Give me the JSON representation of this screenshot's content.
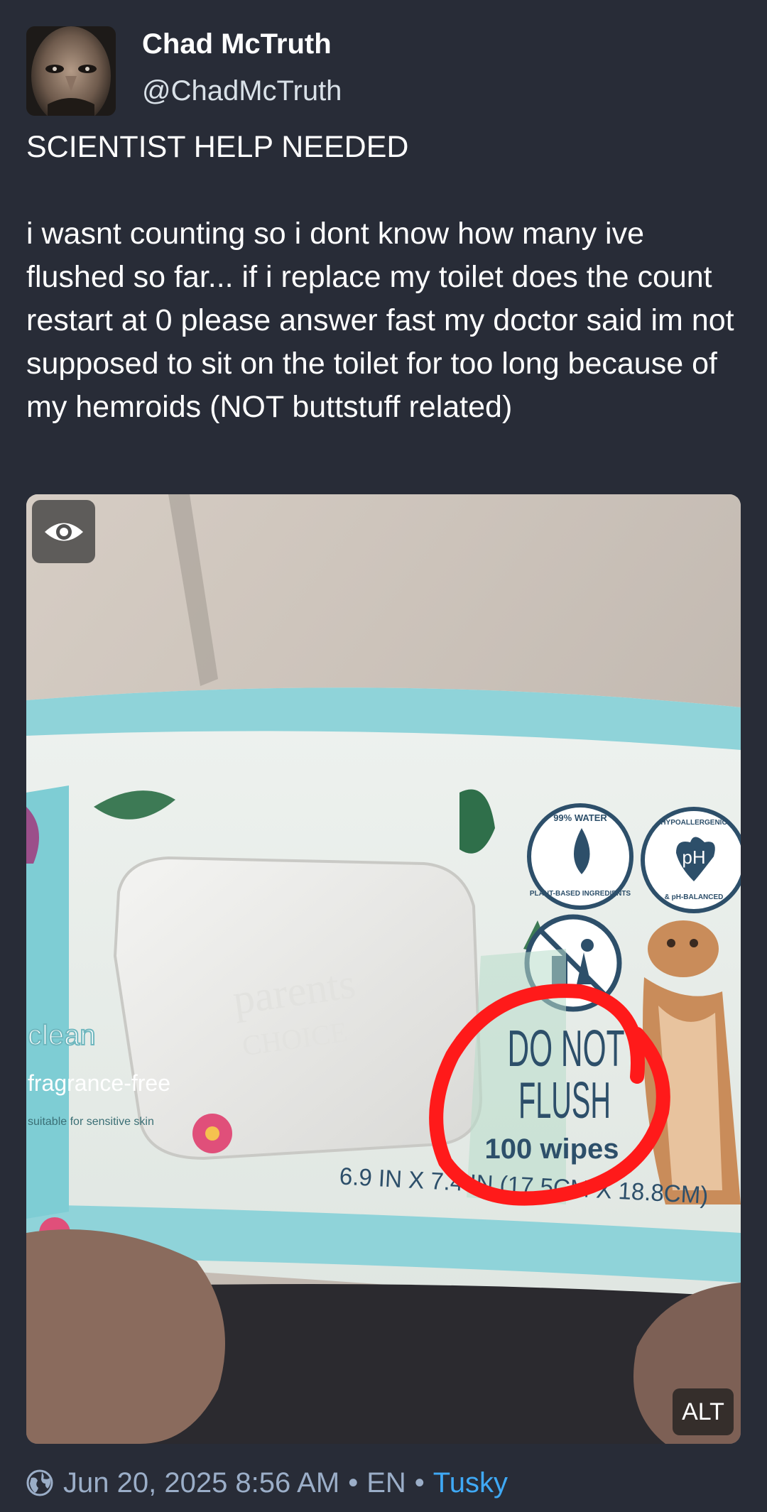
{
  "author": {
    "display_name": "Chad McTruth",
    "handle": "@ChadMcTruth",
    "avatar_icon": "avatar"
  },
  "post": {
    "title_line": "SCIENTIST HELP NEEDED",
    "body": "i wasnt counting so i dont know how many ive flushed so far... if i replace my toilet does the count restart at 0 please answer fast my doctor said im not supposed to sit on the toilet for too long because of my hemroids (NOT buttstuff related)"
  },
  "media": {
    "hide_icon": "eye-icon",
    "alt_label": "ALT",
    "package_text": {
      "do_not": "DO NOT",
      "flush": "FLUSH",
      "wipes": "100 wipes",
      "size": "6.9 IN X 7.4 IN (17.5CM X 18.8CM)",
      "clean": "clean",
      "fragrance": "fragrance-free",
      "sensitive": "suitable for sensitive skin",
      "water": "99% WATER",
      "plant": "PLANT-BASED INGREDIENTS",
      "hypo": "HYPOALLERGENIC",
      "ph_balanced": "& pH-BALANCED",
      "ph": "pH"
    }
  },
  "meta": {
    "visibility_icon": "globe-icon",
    "timestamp": "Jun 20, 2025 8:56 AM",
    "separator": "•",
    "language": "EN",
    "app": "Tusky"
  },
  "colors": {
    "background": "#282c37",
    "secondary_text": "#9baec8",
    "link": "#3fa9f5",
    "circle": "#ff1a1a"
  }
}
